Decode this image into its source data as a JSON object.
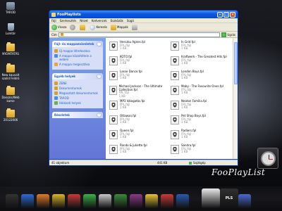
{
  "desktop": {
    "icons": [
      {
        "label": "TAROD"
      },
      {
        "label": "Lomtár"
      },
      {
        "label": "NYOMTATÁS"
      },
      {
        "label": "New kauvalt szolid Feldrö"
      },
      {
        "label": "Dosszis/Web kame"
      },
      {
        "label": "20122006"
      }
    ]
  },
  "window": {
    "title": "FooPlaylists",
    "menu": [
      "Fájl",
      "Szerkesztés",
      "Nézet",
      "Kedvencek",
      "Eszközök",
      "Súgó"
    ],
    "toolbar": {
      "back": "Vissza",
      "search": "Keresés",
      "folders": "Mappák"
    },
    "address": {
      "label": "Cím",
      "value": "",
      "go": "Ugrás"
    }
  },
  "taskpane": {
    "panels": [
      {
        "title": "Fájl- és mappaműveletek",
        "links": [
          "Új mappa létrehozása",
          "A mappa közzététele a weben",
          "A mappa megosztása"
        ]
      },
      {
        "title": "Egyéb helyek",
        "links": [
          "ZENE",
          "Dokumentumok",
          "Megosztott dokumentumok",
          "TAROD",
          "Hálózati helyek"
        ]
      },
      {
        "title": "Részletek",
        "links": []
      }
    ]
  },
  "files": [
    {
      "name": "Herczku Agnes.fpl",
      "type": "FPL fájl",
      "size": "1 KB"
    },
    {
      "name": "In Grid.fpl",
      "type": "FPL fájl",
      "size": "1 KB"
    },
    {
      "name": "KOTO.fpl",
      "type": "FPL fájl",
      "size": "1 KB"
    },
    {
      "name": "Kraftwerk - The Greatest Hits.fpl",
      "type": "FPL fájl",
      "size": "1 KB"
    },
    {
      "name": "Lasse Dance.fpl",
      "type": "FPL fájl",
      "size": "1 KB"
    },
    {
      "name": "London Boys.fpl",
      "type": "FPL fájl",
      "size": "1 KB"
    },
    {
      "name": "Michael Jackson - The Ultimate Collection.fpl",
      "type": "FPL fájl",
      "size": "1 KB"
    },
    {
      "name": "Moby - The Favourite Ones.fpl",
      "type": "FPL fájl",
      "size": "1 KB"
    },
    {
      "name": "MP3 Válogatás.fpl",
      "type": "FPL fájl",
      "size": "1 KB"
    },
    {
      "name": "Neoton Familia.fpl",
      "type": "FPL fájl",
      "size": "1 KB"
    },
    {
      "name": "Ottawan.fpl",
      "type": "FPL fájl",
      "size": "1 KB"
    },
    {
      "name": "Pet Shop Boys.fpl",
      "type": "FPL fájl",
      "size": "1 KB"
    },
    {
      "name": "Queen.fpl",
      "type": "FPL fájl",
      "size": "1 KB"
    },
    {
      "name": "Radiers.fpl",
      "type": "FPL fájl",
      "size": "1 KB"
    },
    {
      "name": "Rondo & Juliette.fpl",
      "type": "FPL fájl",
      "size": "1 KB"
    },
    {
      "name": "Sandra.fpl",
      "type": "FPL fájl",
      "size": "1 KB"
    }
  ],
  "status": {
    "count": "41 objektum",
    "size": "441 KB",
    "zone": "Sajátgép"
  },
  "brand": "FooPlayList",
  "dock": {
    "items": [
      "terminal",
      "blue-bin",
      "firefox",
      "winamp",
      "movies",
      "download",
      "ccleaner",
      "utorrent",
      "burn",
      "chrome",
      "opera",
      "teamviewer",
      "fooplaylist",
      "pls",
      "mail"
    ],
    "pls_label": "PLS"
  }
}
